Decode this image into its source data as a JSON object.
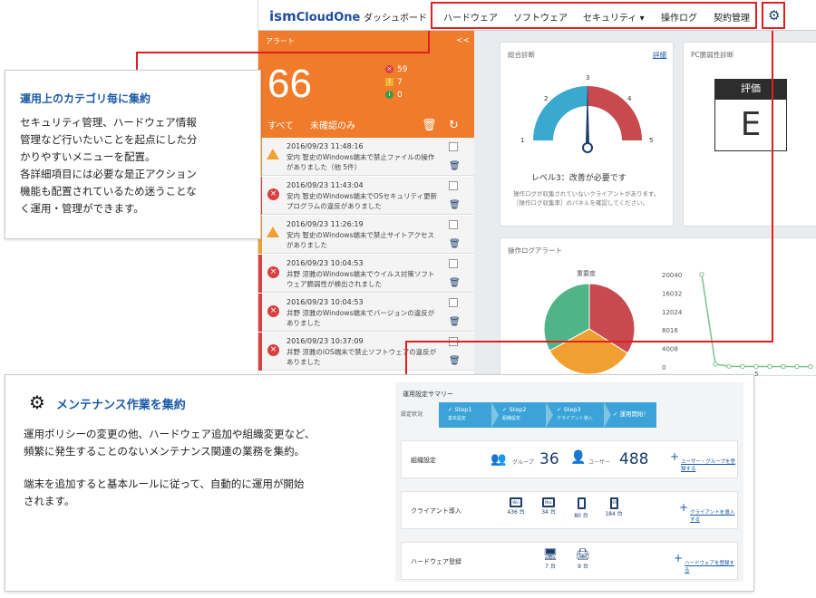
{
  "navbar": {
    "logo_prefix": "ism",
    "logo_text": "CloudOne",
    "items": [
      "ダッシュボード",
      "ハードウェア",
      "ソフトウェア",
      "セキュリティ ▾",
      "操作ログ",
      "契約管理"
    ]
  },
  "alert": {
    "title": "アラート",
    "collapse": "<<",
    "count": "66",
    "stats": {
      "error": "59",
      "warning": "7",
      "info": "0"
    },
    "filter_all": "すべて",
    "filter_unconfirmed": "未確認のみ",
    "rows": [
      {
        "type": "warning",
        "date": "2016/09/23 11:48:16",
        "msg": "安内 智史のWindows端末で禁止ファイルの操作がありました（他 5件）"
      },
      {
        "type": "error",
        "date": "2016/09/23 11:43:04",
        "msg": "安内 智史のWindows端末でOSセキュリティ更新プログラムの違反がありました"
      },
      {
        "type": "warning",
        "date": "2016/09/23 11:26:19",
        "msg": "安内 智史のWindows端末で禁止サイトアクセスがありました"
      },
      {
        "type": "error",
        "date": "2016/09/23 10:04:53",
        "msg": "井野 涼雅のWindows端末でウイルス対策ソフトウェア脆弱性が検出されました"
      },
      {
        "type": "error",
        "date": "2016/09/23 10:04:53",
        "msg": "井野 涼雅のWindows端末でバージョンの違反がありました"
      },
      {
        "type": "error",
        "date": "2016/09/23 10:37:09",
        "msg": "井野 涼雅のiOS端末で禁止ソフトウェアの違反がありました"
      }
    ]
  },
  "diagnosis": {
    "title": "総合診断",
    "detail_link": "詳細",
    "gauge_ticks": [
      "1",
      "2",
      "3",
      "4",
      "5"
    ],
    "gauge_value": 3,
    "level_text": "レベル3：改善が必要です",
    "note": "操作ログが収集されていないクライアントがあります。［操作ログ収集率］のパネルを確認してください。"
  },
  "pc_diag": {
    "title": "PC脆弱性診断",
    "rating_label": "評価",
    "rating": "E"
  },
  "ops": {
    "title": "操作ログアラート",
    "pie_title": "重要度",
    "y_ticks": [
      "20040",
      "16032",
      "12024",
      "8016",
      "4008",
      "0"
    ],
    "x_tick": "5"
  },
  "chart_data": [
    {
      "type": "pie",
      "title": "重要度",
      "slices": [
        {
          "value": 34,
          "color": "#c94a4e"
        },
        {
          "value": 33,
          "color": "#f0a030"
        },
        {
          "value": 33,
          "color": "#4fb588"
        }
      ]
    },
    {
      "type": "line",
      "y_ticks": [
        20040,
        16032,
        12024,
        8016,
        4008,
        0
      ],
      "ylim": [
        0,
        20040
      ],
      "x": [
        1,
        2,
        3,
        4,
        5,
        6,
        7,
        8,
        9
      ],
      "values": [
        20040,
        600,
        150,
        120,
        100,
        100,
        90,
        80,
        80
      ]
    }
  ],
  "callout1": {
    "title": "運用上のカテゴリ毎に集約",
    "lines": [
      "セキュリティ管理、ハードウェア情報",
      "管理など行いたいことを起点にした分",
      "かりやすいメニューを配置。",
      "各詳細項目には必要な是正アクション",
      "機能も配置されているため迷うことな",
      "く運用・管理ができます。"
    ]
  },
  "callout2": {
    "title": "メンテナンス作業を集約",
    "lines": [
      "運用ポリシーの変更の他、ハードウェア追加や組織変更など、",
      "頻繁に発生することのないメンテナンス関連の業務を集約。",
      "",
      "端末を追加すると基本ルールに従って、自動的に運用が開始",
      "されます。"
    ]
  },
  "summary": {
    "title": "運用設定サマリー",
    "status_label": "設定状況",
    "steps": [
      {
        "name": "Step1",
        "sub": "基本設定"
      },
      {
        "name": "Step2",
        "sub": "組織設定"
      },
      {
        "name": "Step3",
        "sub": "クライアント導入"
      },
      {
        "name": "運用開始！",
        "sub": ""
      }
    ],
    "org": {
      "label": "組織設定",
      "group_label": "グループ",
      "group_count": "36",
      "user_label": "ユーザー",
      "user_count": "488",
      "action": "ユーザー・グループを登録する"
    },
    "client": {
      "label": "クライアント導入",
      "devices": [
        {
          "icon": "Win",
          "count": "436 台"
        },
        {
          "icon": "Mac",
          "count": "34 台"
        },
        {
          "icon": "Android",
          "count": "80 台"
        },
        {
          "icon": "iOS",
          "count": "184 台"
        }
      ],
      "action": "クライアントを導入する"
    },
    "hardware": {
      "label": "ハードウェア登録",
      "devices": [
        {
          "icon": "monitor",
          "count": "7 台"
        },
        {
          "icon": "printer",
          "count": "9 台"
        }
      ],
      "action": "ハードウェアを登録する"
    }
  }
}
